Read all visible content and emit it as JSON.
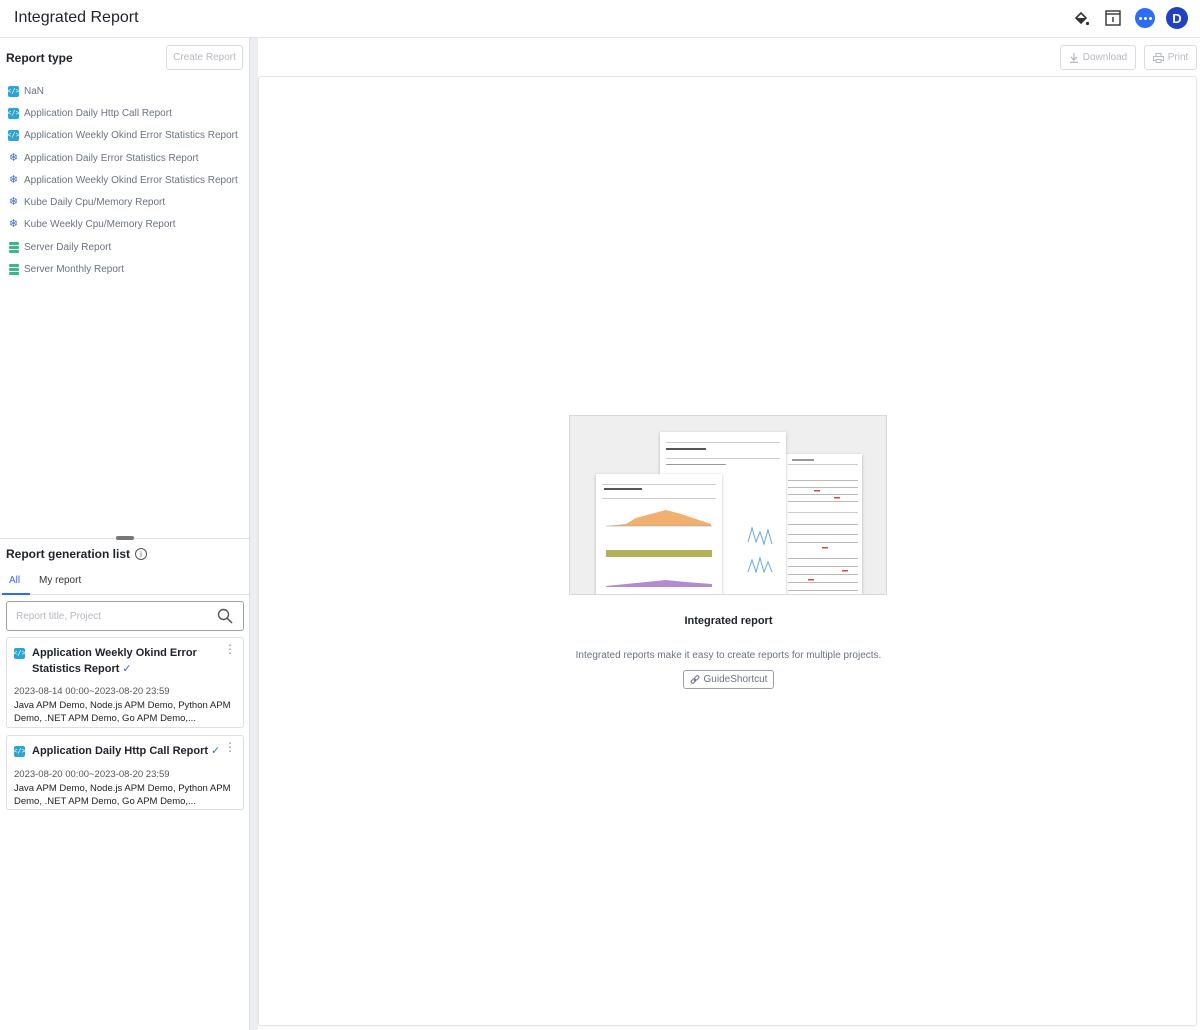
{
  "header": {
    "title": "Integrated Report",
    "avatar_letter": "D",
    "icons": [
      "paint-bucket-icon",
      "info-panel-icon",
      "chat-icon",
      "avatar"
    ]
  },
  "report_type": {
    "title": "Report type",
    "create_label": "Create Report",
    "items": [
      {
        "label": "NaN",
        "icon": "code-icon"
      },
      {
        "label": "Application Daily Http Call Report",
        "icon": "code-icon"
      },
      {
        "label": "Application Weekly Okind Error Statistics Report",
        "icon": "code-icon"
      },
      {
        "label": "Application Daily Error Statistics Report",
        "icon": "kubernetes-icon"
      },
      {
        "label": "Application Weekly Okind Error Statistics Report",
        "icon": "kubernetes-icon"
      },
      {
        "label": "Kube Daily Cpu/Memory Report",
        "icon": "kubernetes-icon"
      },
      {
        "label": "Kube Weekly Cpu/Memory Report",
        "icon": "kubernetes-icon"
      },
      {
        "label": "Server Daily Report",
        "icon": "server-icon"
      },
      {
        "label": "Server Monthly Report",
        "icon": "server-icon"
      }
    ]
  },
  "generation_list": {
    "title": "Report generation list",
    "tabs": [
      "All",
      "My report"
    ],
    "active_tab": "All",
    "search_placeholder": "Report title, Project",
    "search_value": "",
    "cards": [
      {
        "title": "Application Weekly Okind Error Statistics Report",
        "date": "2023-08-14 00:00~2023-08-20 23:59",
        "projects": "Java APM Demo, Node.js APM Demo, Python APM Demo, .NET APM Demo, Go APM Demo,..."
      },
      {
        "title": "Application Daily Http Call Report",
        "date": "2023-08-20 00:00~2023-08-20 23:59",
        "projects": "Java APM Demo, Node.js APM Demo, Python APM Demo, .NET APM Demo, Go APM Demo,..."
      }
    ]
  },
  "toolbar": {
    "download_label": "Download",
    "print_label": "Print"
  },
  "empty_state": {
    "title": "Integrated report",
    "description": "Integrated reports make it easy to create reports for multiple projects.",
    "guide_label": "GuideShortcut"
  },
  "colors": {
    "accent": "#2d6df6",
    "avatar_bg": "#2140c4",
    "code_icon": "#2aa5d6",
    "kube_icon": "#326ce5",
    "server_icon": "#3bb88a"
  }
}
